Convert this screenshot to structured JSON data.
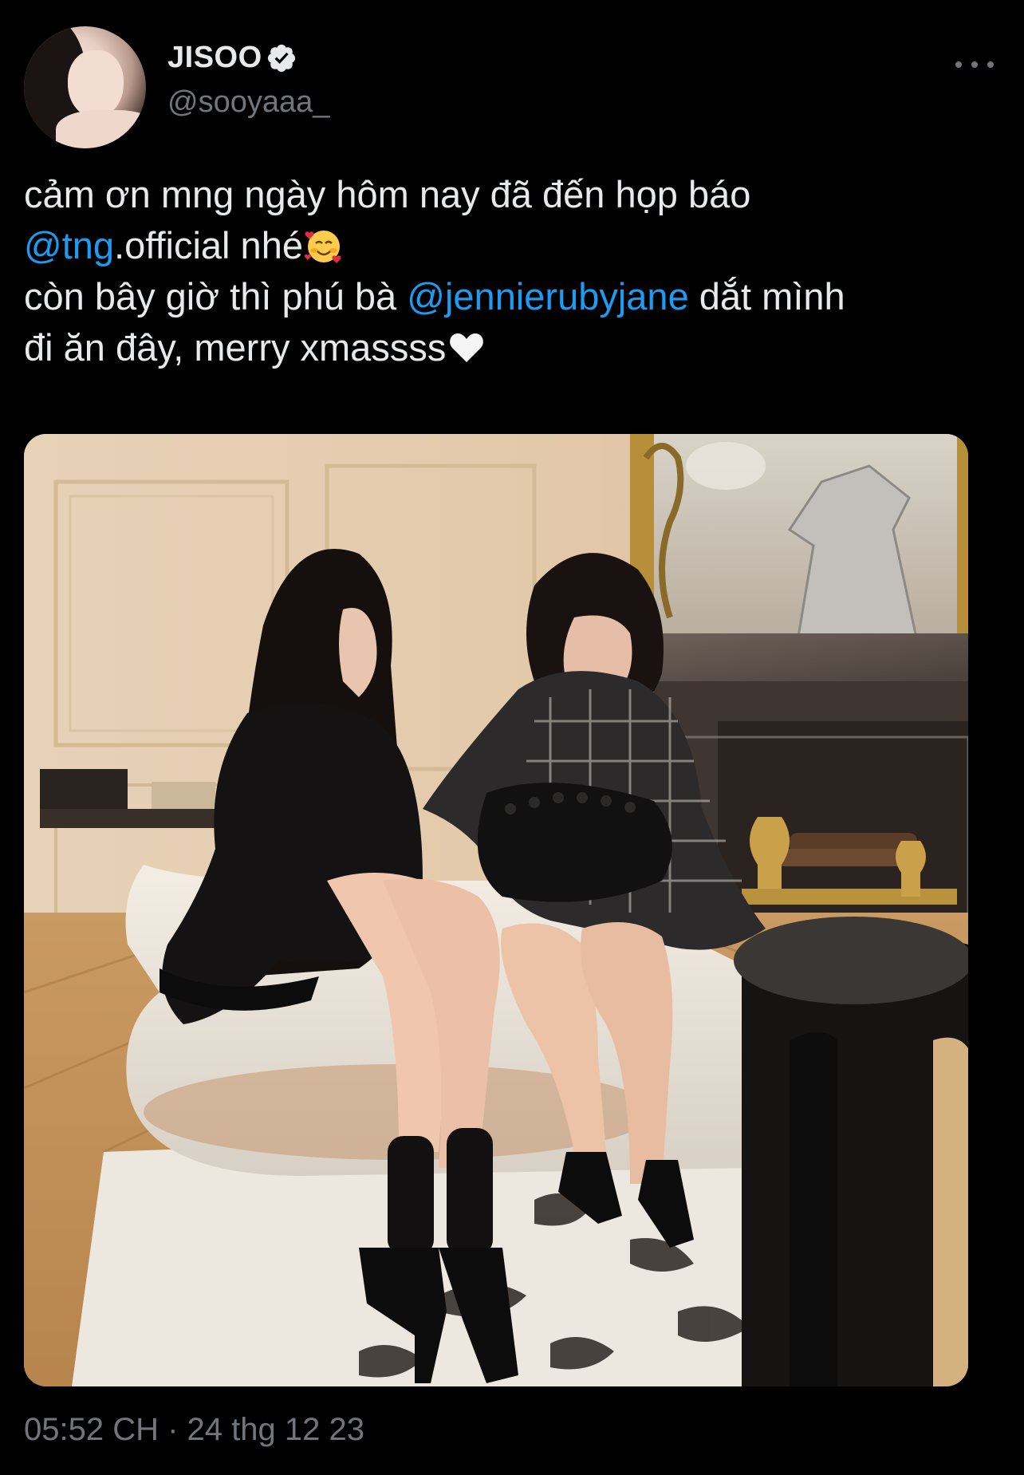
{
  "author": {
    "display_name": "JISOO",
    "handle": "@sooyaaa_",
    "verified": true,
    "avatar_icon": "profile-photo"
  },
  "tweet": {
    "line1": "cảm ơn mng ngày hôm nay đã đến họp báo",
    "line2_mention": "@tng",
    "line2_rest": ".official nhé",
    "line2_emoji": "smiling-face-with-hearts-emoji",
    "line3_prefix": "còn bây giờ thì phú bà ",
    "line3_mention": "@jennierubyjane",
    "line3_suffix": " dắt mình",
    "line4": "đi ăn đây, merry xmassss",
    "line4_emoji": "white-heart-emoji"
  },
  "media": {
    "type": "photo",
    "icon": "photo-two-women-on-sofa"
  },
  "meta": {
    "timestamp": "05:52 CH · 24 thg 12 23"
  },
  "colors": {
    "background": "#000000",
    "text": "#e7e9ea",
    "secondary": "#71767b",
    "mention": "#1d9bf0"
  }
}
